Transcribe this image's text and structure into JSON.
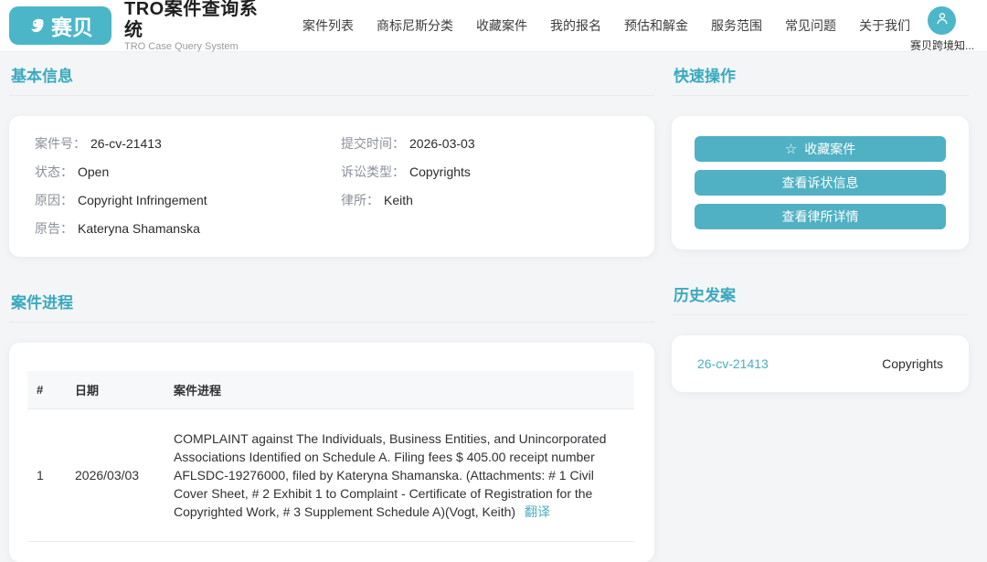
{
  "colors": {
    "accent": "#4fb1c3",
    "heading_teal": "#3aa9bd",
    "link_teal": "#4aafc2",
    "logo_teal": "#4cb6c9"
  },
  "icons": {
    "star": "☆",
    "user_avatar": "person-silhouette",
    "logo_mark": "saibei-swirl"
  },
  "header": {
    "logo_text": "赛贝",
    "title": "TRO案件查询系统",
    "subtitle": "TRO Case Query System",
    "nav": [
      {
        "label": "案件列表"
      },
      {
        "label": "商标尼斯分类"
      },
      {
        "label": "收藏案件"
      },
      {
        "label": "我的报名"
      },
      {
        "label": "预估和解金"
      },
      {
        "label": "服务范围"
      },
      {
        "label": "常见问题"
      },
      {
        "label": "关于我们"
      }
    ],
    "user_name": "赛贝跨境知..."
  },
  "basic_info": {
    "heading": "基本信息",
    "fields": [
      {
        "label": "案件号：",
        "value": "26-cv-21413"
      },
      {
        "label": "提交时间：",
        "value": "2026-03-03"
      },
      {
        "label": "状态：",
        "value": "Open"
      },
      {
        "label": "诉讼类型：",
        "value": "Copyrights"
      },
      {
        "label": "原因：",
        "value": "Copyright Infringement"
      },
      {
        "label": "律所：",
        "value": "Keith"
      },
      {
        "label": "原告：",
        "value": "Kateryna Shamanska"
      }
    ]
  },
  "quick_actions": {
    "heading": "快速操作",
    "favorite_icon": "☆",
    "buttons": [
      {
        "label": "收藏案件"
      },
      {
        "label": "查看诉状信息"
      },
      {
        "label": "查看律所详情"
      }
    ]
  },
  "case_progress": {
    "heading": "案件进程",
    "columns": [
      "#",
      "日期",
      "案件进程"
    ],
    "rows": [
      {
        "index": "1",
        "date": "2026/03/03",
        "description": "COMPLAINT against The Individuals, Business Entities, and Unincorporated Associations Identified on Schedule A. Filing fees $ 405.00 receipt number AFLSDC-19276000, filed by Kateryna Shamanska. (Attachments: # 1 Civil Cover Sheet, # 2 Exhibit 1 to Complaint - Certificate of Registration for the Copyrighted Work, # 3 Supplement Schedule A)(Vogt, Keith)",
        "translate_label": "翻译"
      }
    ]
  },
  "history": {
    "heading": "历史发案",
    "items": [
      {
        "case_no": "26-cv-21413",
        "type": "Copyrights"
      }
    ]
  }
}
